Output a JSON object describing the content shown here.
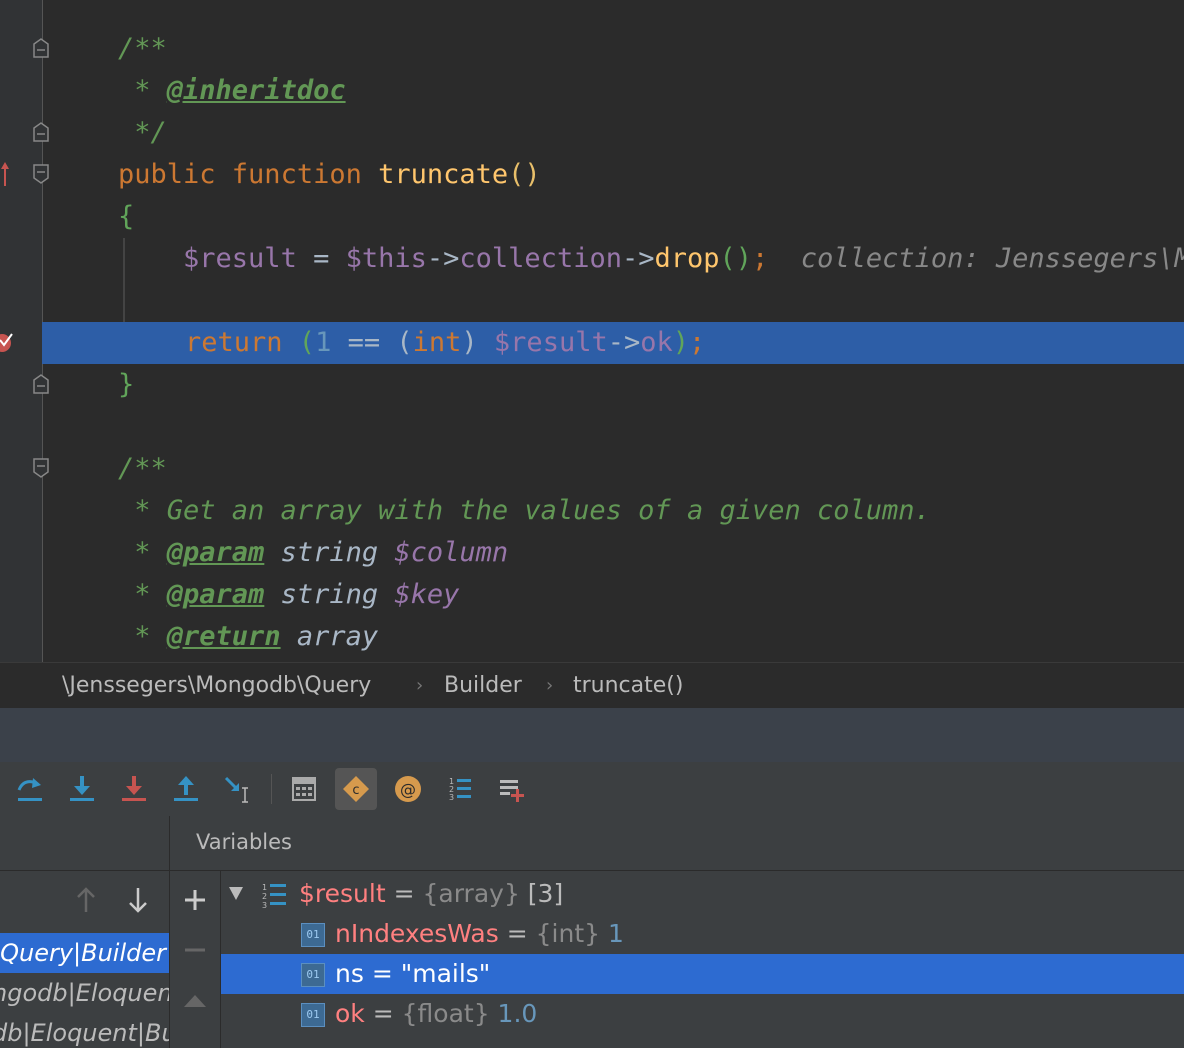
{
  "editor": {
    "lines": [
      {
        "segments": [
          {
            "t": "/**",
            "c": "cm"
          }
        ]
      },
      {
        "segments": [
          {
            "t": " * ",
            "c": "cm"
          },
          {
            "t": "@inheritdoc",
            "c": "tag"
          }
        ]
      },
      {
        "segments": [
          {
            "t": " */",
            "c": "cm"
          }
        ]
      },
      {
        "segments": [
          {
            "t": "public ",
            "c": "kw"
          },
          {
            "t": "function ",
            "c": "kw"
          },
          {
            "t": "truncate",
            "c": "fn"
          },
          {
            "t": "()",
            "c": "br2"
          }
        ]
      },
      {
        "segments": [
          {
            "t": "{",
            "c": "br"
          }
        ]
      },
      {
        "segments": [
          {
            "t": "    "
          },
          {
            "t": "$result",
            "c": "var"
          },
          {
            "t": " = ",
            "c": "plain"
          },
          {
            "t": "$this",
            "c": "var"
          },
          {
            "t": "->",
            "c": "plain"
          },
          {
            "t": "collection",
            "c": "var"
          },
          {
            "t": "->",
            "c": "plain"
          },
          {
            "t": "drop",
            "c": "fn"
          },
          {
            "t": "()",
            "c": "br"
          },
          {
            "t": ";",
            "c": "kw"
          },
          {
            "t": "  collection: Jenssegers\\Mo",
            "c": "hint"
          }
        ]
      },
      {
        "segments": []
      },
      {
        "segments": [
          {
            "t": "return ",
            "c": "kw"
          },
          {
            "t": "(",
            "c": "br"
          },
          {
            "t": "1",
            "c": "num"
          },
          {
            "t": " == ",
            "c": "plain"
          },
          {
            "t": "(",
            "c": "plain"
          },
          {
            "t": "int",
            "c": "kw"
          },
          {
            "t": ") ",
            "c": "plain"
          },
          {
            "t": "$result",
            "c": "var"
          },
          {
            "t": "->",
            "c": "plain"
          },
          {
            "t": "ok",
            "c": "var"
          },
          {
            "t": ")",
            "c": "br"
          },
          {
            "t": ";",
            "c": "kw"
          }
        ]
      },
      {
        "segments": [
          {
            "t": "}",
            "c": "br"
          }
        ]
      },
      {
        "segments": []
      },
      {
        "segments": [
          {
            "t": "/**",
            "c": "cm"
          }
        ]
      },
      {
        "segments": [
          {
            "t": " * Get an array with the values of a given column.",
            "c": "cm"
          }
        ]
      },
      {
        "segments": [
          {
            "t": " * ",
            "c": "cm"
          },
          {
            "t": "@param",
            "c": "tag"
          },
          {
            "t": " string ",
            "c": "typ"
          },
          {
            "t": "$column",
            "c": "pvar"
          }
        ]
      },
      {
        "segments": [
          {
            "t": " * ",
            "c": "cm"
          },
          {
            "t": "@param",
            "c": "tag"
          },
          {
            "t": " string ",
            "c": "typ"
          },
          {
            "t": "$key",
            "c": "pvar"
          }
        ]
      },
      {
        "segments": [
          {
            "t": " * ",
            "c": "cm"
          },
          {
            "t": "@return",
            "c": "tag"
          },
          {
            "t": " array",
            "c": "typ"
          }
        ]
      }
    ]
  },
  "breadcrumb": {
    "namespace": "\\Jenssegers\\Mongodb\\Query",
    "class": "Builder",
    "method": "truncate()"
  },
  "toolbar": {
    "buttons": [
      "step-over",
      "step-into",
      "force-step-into",
      "step-out",
      "run-to-cursor",
      "evaluate-expression",
      "show-class-constants",
      "watch",
      "show-values",
      "add-watch"
    ]
  },
  "frames": {
    "items": [
      "\\Query|Builder",
      "ngodb|Eloquent",
      "db|Eloquent|Bu"
    ]
  },
  "variables": {
    "title": "Variables",
    "rows": [
      {
        "name": "$result",
        "eq": " = ",
        "type": "{array}",
        "value": " [3]"
      },
      {
        "name": "nIndexesWas",
        "eq": " = ",
        "type": "{int}",
        "value": " 1"
      },
      {
        "name": "ns",
        "eq": " = ",
        "type": "",
        "value": "\"mails\""
      },
      {
        "name": "ok",
        "eq": " = ",
        "type": "{float}",
        "value": " 1.0"
      }
    ]
  },
  "colors": {
    "accent_selection": "#2d6bd1",
    "current_line": "#2d5ea7",
    "comment": "#629755",
    "keyword": "#cc7832",
    "function": "#ffc66d",
    "variable": "#9876aa"
  }
}
